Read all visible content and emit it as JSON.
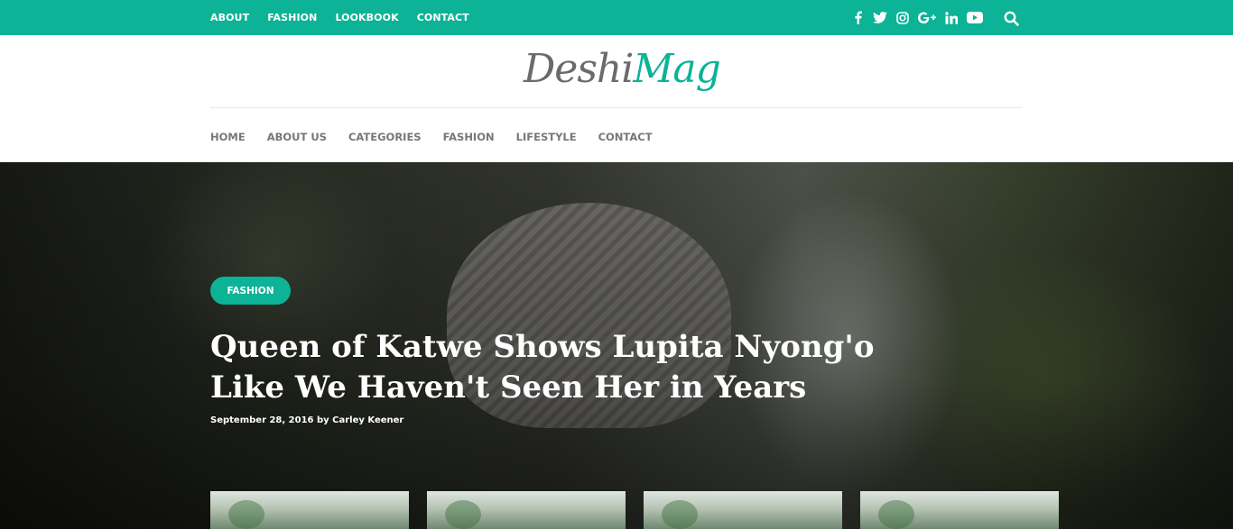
{
  "top_nav": [
    "ABOUT",
    "FASHION",
    "LOOKBOOK",
    "CONTACT"
  ],
  "social_icons": [
    "facebook-icon",
    "twitter-icon",
    "instagram-icon",
    "google-plus-icon",
    "linkedin-icon",
    "youtube-icon"
  ],
  "search_icon": "search-icon",
  "logo": {
    "part1": "Deshi",
    "part2": "Mag"
  },
  "main_nav": [
    "HOME",
    "ABOUT US",
    "CATEGORIES",
    "FASHION",
    "LIFESTYLE",
    "CONTACT"
  ],
  "hero": {
    "category": "FASHION",
    "title": "Queen of Katwe Shows Lupita Nyong'o Like We Haven't Seen Her in Years",
    "meta": "September 28, 2016 by Carley Keener"
  },
  "colors": {
    "accent": "#0cb396",
    "nav_text": "#777777",
    "logo_gray": "#6b6b6b"
  }
}
